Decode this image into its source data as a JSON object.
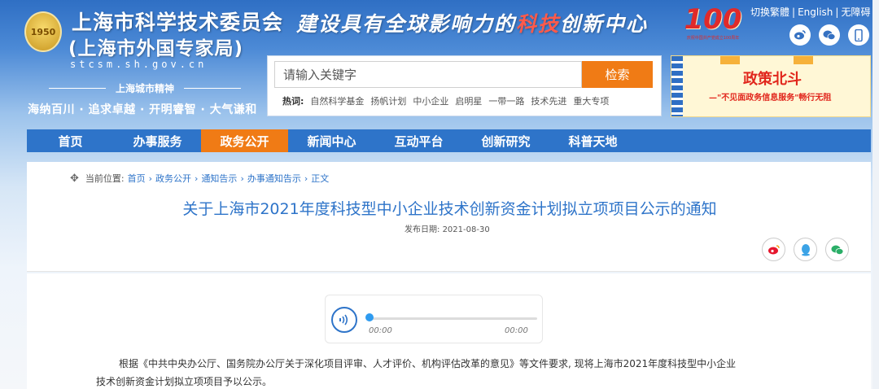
{
  "header": {
    "emblem_text": "1950",
    "org_title": "上海市科学技术委员会",
    "org_subtitle": "(上海市外国专家局)",
    "domain": "stcsm.sh.gov.cn",
    "spirit_label": "上海城市精神",
    "spirit_motto": "海纳百川 · 追求卓越 · 开明睿智 · 大气谦和",
    "slogan_part1": "建设具有全球影响力的",
    "slogan_part2": "科技",
    "slogan_part3": "创新中心",
    "badge_number": "100",
    "badge_caption": "庆祝中国共产党成立100周年",
    "top_links": [
      "切换繁體",
      "English",
      "无障碍"
    ],
    "social_icons": [
      "weibo-icon",
      "wechat-icon",
      "mobile-icon"
    ]
  },
  "search": {
    "placeholder": "请输入关键字",
    "button_label": "检索",
    "hot_label": "热词:",
    "hot_words": [
      "自然科学基金",
      "扬帆计划",
      "中小企业",
      "启明星",
      "一带一路",
      "技术先进",
      "重大专项"
    ]
  },
  "banner": {
    "title": "政策北斗",
    "subtitle": "—\"不见面政务信息服务\"畅行无阻"
  },
  "nav": {
    "items": [
      "首页",
      "办事服务",
      "政务公开",
      "新闻中心",
      "互动平台",
      "创新研究",
      "科普天地"
    ],
    "active_index": 2
  },
  "article": {
    "breadcrumb_label": "当前位置:",
    "breadcrumb": [
      "首页",
      "政务公开",
      "通知告示",
      "办事通知告示",
      "正文"
    ],
    "title": "关于上海市2021年度科技型中小企业技术创新资金计划拟立项项目公示的通知",
    "date_label": "发布日期:",
    "date": "2021-08-30",
    "share": [
      "weibo-icon",
      "qq-icon",
      "wechat-icon"
    ],
    "audio": {
      "current_time": "00:00",
      "total_time": "00:00",
      "progress": 0
    },
    "paragraph_line1": "根据《中共中央办公厅、国务院办公厅关于深化项目评审、人才评价、机构评估改革的意见》等文件要求, 现将上海市2021年度科技型中小企业",
    "paragraph_line2": "技术创新资金计划拟立项项目予以公示。"
  }
}
